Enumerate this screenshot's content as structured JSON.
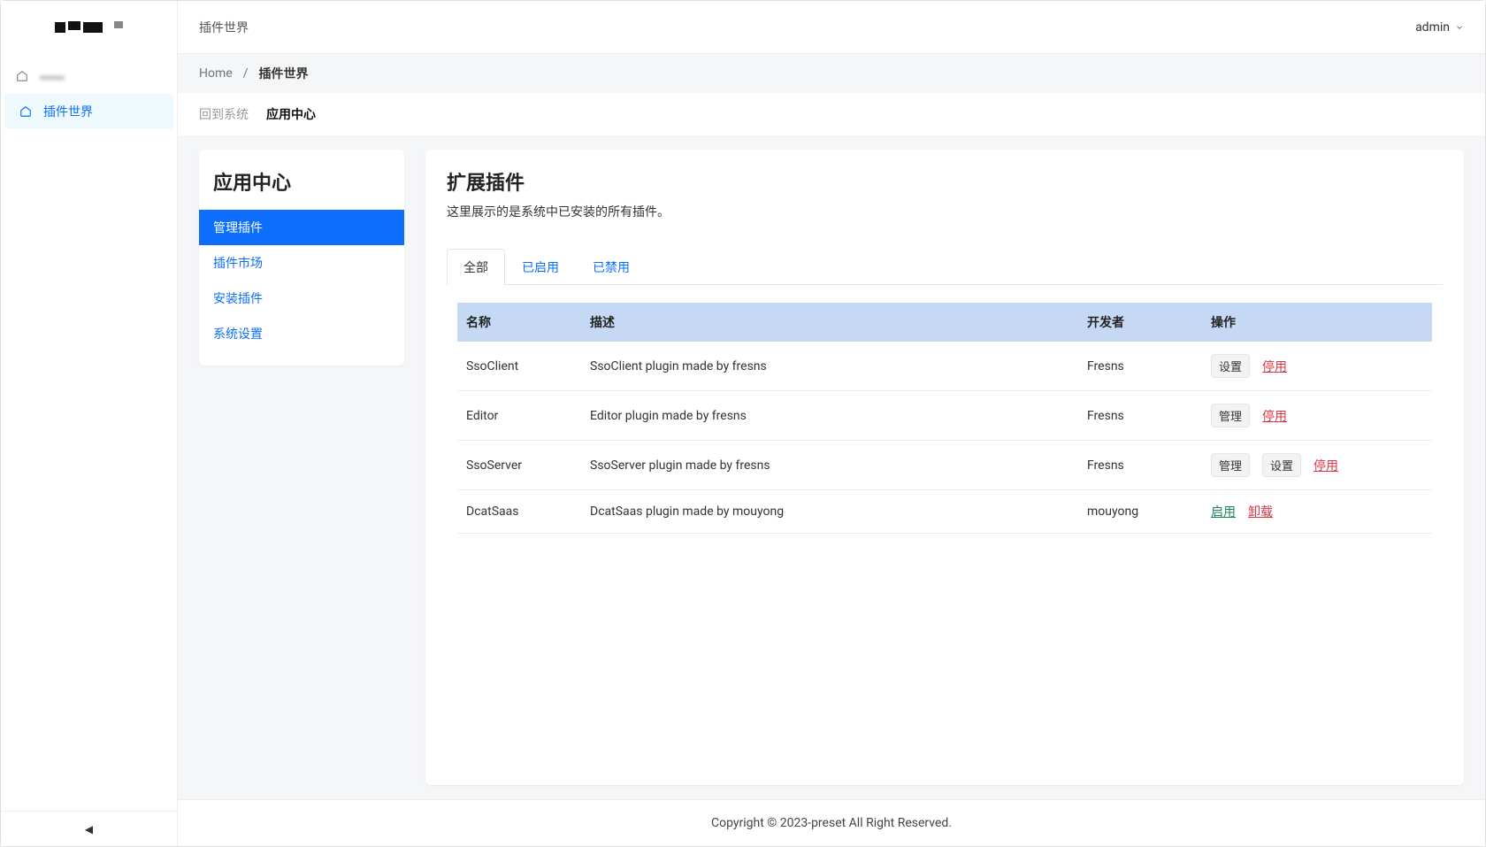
{
  "sidebar": {
    "nav": [
      {
        "label": "···"
      },
      {
        "label": "插件世界"
      }
    ]
  },
  "header": {
    "title": "插件世界",
    "user": "admin"
  },
  "breadcrumb": {
    "home": "Home",
    "sep": "/",
    "current": "插件世界"
  },
  "subnav": {
    "back": "回到系统",
    "current": "应用中心"
  },
  "aside": {
    "title": "应用中心",
    "items": [
      "管理插件",
      "插件市场",
      "安装插件",
      "系统设置"
    ]
  },
  "panel": {
    "title": "扩展插件",
    "desc": "这里展示的是系统中已安装的所有插件。"
  },
  "tabs": {
    "all": "全部",
    "enabled": "已启用",
    "disabled": "已禁用"
  },
  "columns": {
    "name": "名称",
    "desc": "描述",
    "developer": "开发者",
    "actions": "操作"
  },
  "actions": {
    "settings": "设置",
    "manage": "管理",
    "disable": "停用",
    "enable": "启用",
    "uninstall": "卸载"
  },
  "rows": [
    {
      "name": "SsoClient",
      "desc": "SsoClient plugin made by fresns",
      "developer": "Fresns",
      "buttons": [
        "settings"
      ],
      "link": "disable"
    },
    {
      "name": "Editor",
      "desc": "Editor plugin made by fresns",
      "developer": "Fresns",
      "buttons": [
        "manage"
      ],
      "link": "disable"
    },
    {
      "name": "SsoServer",
      "desc": "SsoServer plugin made by fresns",
      "developer": "Fresns",
      "buttons": [
        "manage",
        "settings"
      ],
      "link": "disable"
    },
    {
      "name": "DcatSaas",
      "desc": "DcatSaas plugin made by mouyong",
      "developer": "mouyong",
      "enable_link": "enable",
      "uninstall_link": "uninstall"
    }
  ],
  "footer": "Copyright © 2023-preset All Right Reserved."
}
